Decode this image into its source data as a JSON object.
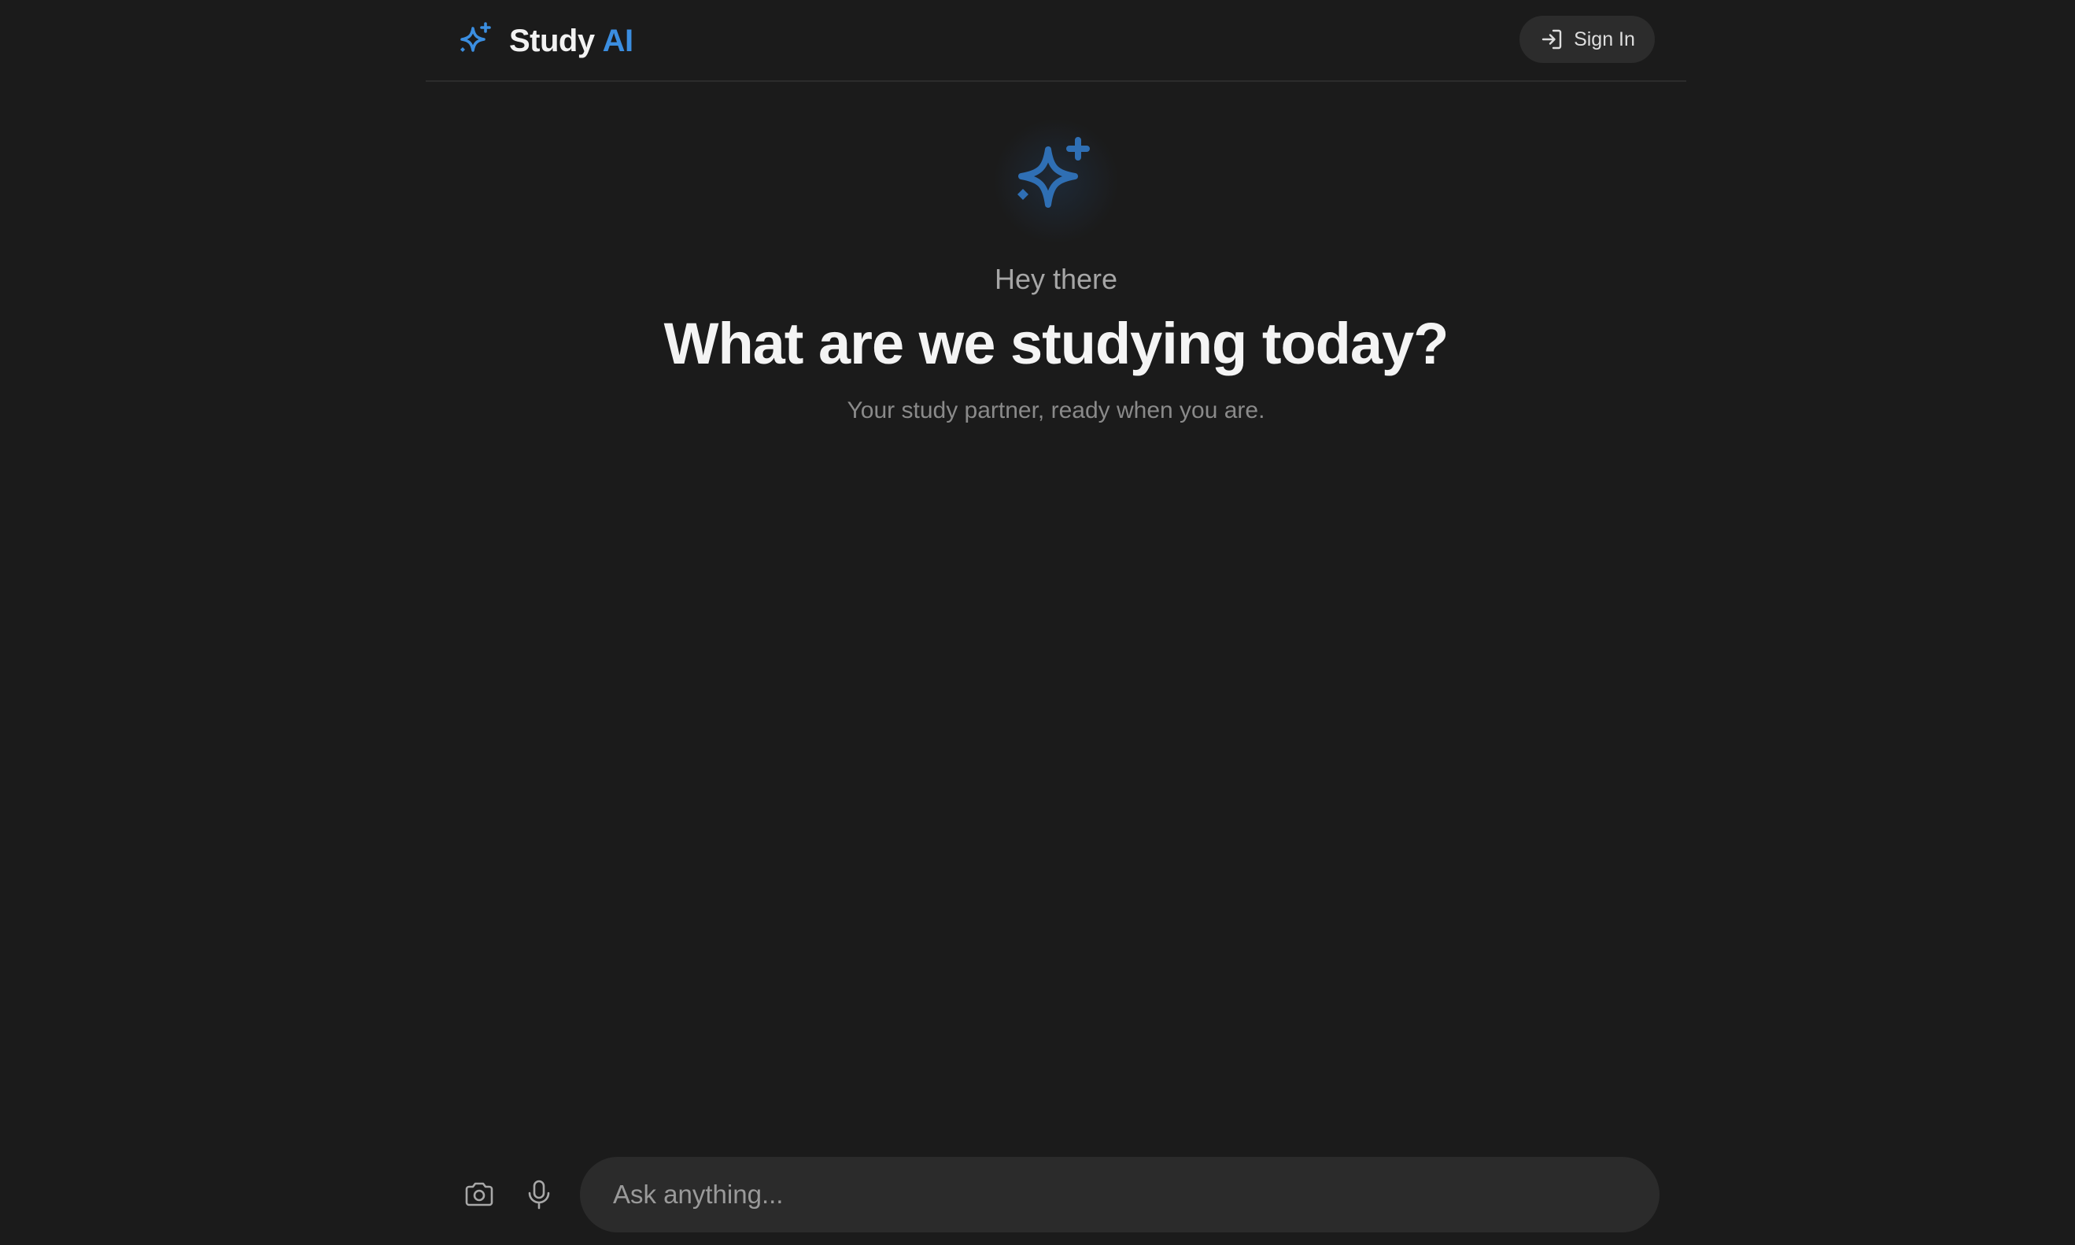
{
  "header": {
    "brand_name": "Study",
    "brand_accent": "AI",
    "brand_icon": "sparkle-icon",
    "signin_label": "Sign In",
    "signin_icon": "sign-in-icon"
  },
  "hero": {
    "icon": "sparkle-icon",
    "greeting": "Hey there",
    "headline": "What are we studying today?",
    "subtitle": "Your study partner, ready when you are."
  },
  "composer": {
    "camera_icon": "camera-icon",
    "mic_icon": "microphone-icon",
    "placeholder": "Ask anything..."
  },
  "colors": {
    "background": "#1b1b1b",
    "accent": "#3b8ee0",
    "hero_icon": "#2f6fb4",
    "surface": "#2b2b2b"
  }
}
